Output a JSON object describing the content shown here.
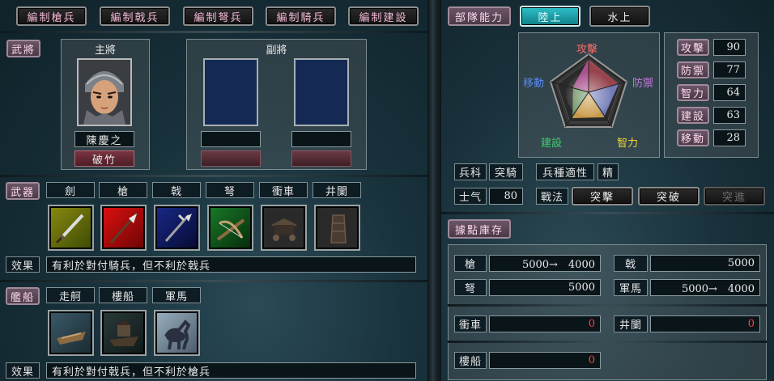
{
  "top_buttons": [
    "編制槍兵",
    "編制戟兵",
    "編制弩兵",
    "編制騎兵",
    "編制建設"
  ],
  "general": {
    "tag": "武將",
    "main_label": "主將",
    "sub_label": "副將",
    "main_name": "陳慶之",
    "main_skill": "破竹"
  },
  "weapons": {
    "tag": "武器",
    "items": [
      "劍",
      "槍",
      "戟",
      "弩",
      "衝車",
      "井闌"
    ],
    "effect_label": "效果",
    "effect_text": "有利於對付騎兵，但不利於戟兵"
  },
  "ships": {
    "tag": "艦船",
    "items": [
      "走舸",
      "樓船",
      "軍馬"
    ],
    "effect_label": "效果",
    "effect_text": "有利於對付戟兵，但不利於槍兵"
  },
  "ability": {
    "tag": "部隊能力",
    "tab_land": "陸上",
    "tab_water": "水上",
    "radar_labels": {
      "attack": "攻擊",
      "defense": "防禦",
      "intellect": "智力",
      "build": "建設",
      "move": "移動"
    },
    "stats": [
      {
        "label": "攻擊",
        "value": "90"
      },
      {
        "label": "防禦",
        "value": "77"
      },
      {
        "label": "智力",
        "value": "64"
      },
      {
        "label": "建設",
        "value": "63"
      },
      {
        "label": "移動",
        "value": "28"
      }
    ],
    "unit_type_label": "兵科",
    "unit_type_value": "突騎",
    "aptitude_label": "兵種適性",
    "aptitude_value": "精",
    "morale_label": "士气",
    "morale_value": "80",
    "tactics_label": "戰法",
    "tactics": [
      "突擊",
      "突破",
      "突進"
    ]
  },
  "storage": {
    "tag": "據點庫存",
    "rows": [
      {
        "label": "槍",
        "value": "5000→　4000"
      },
      {
        "label": "戟",
        "value": "5000"
      },
      {
        "label": "弩",
        "value": "5000"
      },
      {
        "label": "軍馬",
        "value": "5000→　4000"
      },
      {
        "label": "衝車",
        "value": "0"
      },
      {
        "label": "井闌",
        "value": "0"
      },
      {
        "label": "樓船",
        "value": "0"
      }
    ]
  },
  "colors": {
    "accent_teal": "#1aa8b2",
    "tag_pink": "#ffd9ef",
    "zero_red": "#ff4040"
  },
  "icons": {
    "weapons": [
      "sword-icon",
      "spear-icon",
      "halberd-icon",
      "crossbow-icon",
      "battering-ram-icon",
      "siege-tower-icon"
    ],
    "ships": [
      "small-boat-icon",
      "large-ship-icon",
      "warhorse-icon"
    ]
  }
}
